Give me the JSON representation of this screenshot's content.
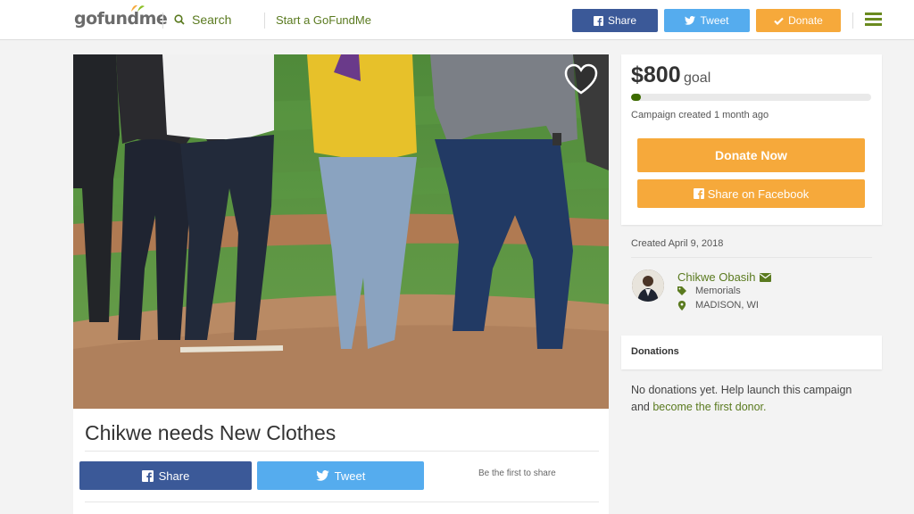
{
  "header": {
    "logo": "gofundme",
    "search_label": "Search",
    "start_link": "Start a GoFundMe",
    "share_label": "Share",
    "tweet_label": "Tweet",
    "donate_label": "Donate",
    "icons": [
      "logo-icon",
      "search-icon",
      "facebook-icon",
      "twitter-icon",
      "check-icon",
      "hamburger-menu-icon"
    ]
  },
  "campaign": {
    "title": "Chikwe needs New Clothes",
    "share_label": "Share",
    "tweet_label": "Tweet",
    "first_share_text": "Be the first to share"
  },
  "goal": {
    "amount": "$800",
    "label": "goal",
    "progress": 0.02,
    "created_ago": "Campaign created 1 month ago",
    "donate_now": "Donate Now",
    "share_facebook": "Share on Facebook"
  },
  "details": {
    "created_date": "Created April 9, 2018",
    "organizer": "Chikwe Obasih",
    "category": "Memorials",
    "location": "MADISON, WI"
  },
  "donations": {
    "heading": "Donations",
    "empty_text": "No donations yet. Help launch this campaign and",
    "empty_link": "become the first donor."
  },
  "colors": {
    "brand_green": "#5a7a1f",
    "donate_orange": "#f6a93b",
    "facebook_blue": "#3b5998",
    "twitter_blue": "#55acee",
    "progress_green": "#3d6b00"
  }
}
